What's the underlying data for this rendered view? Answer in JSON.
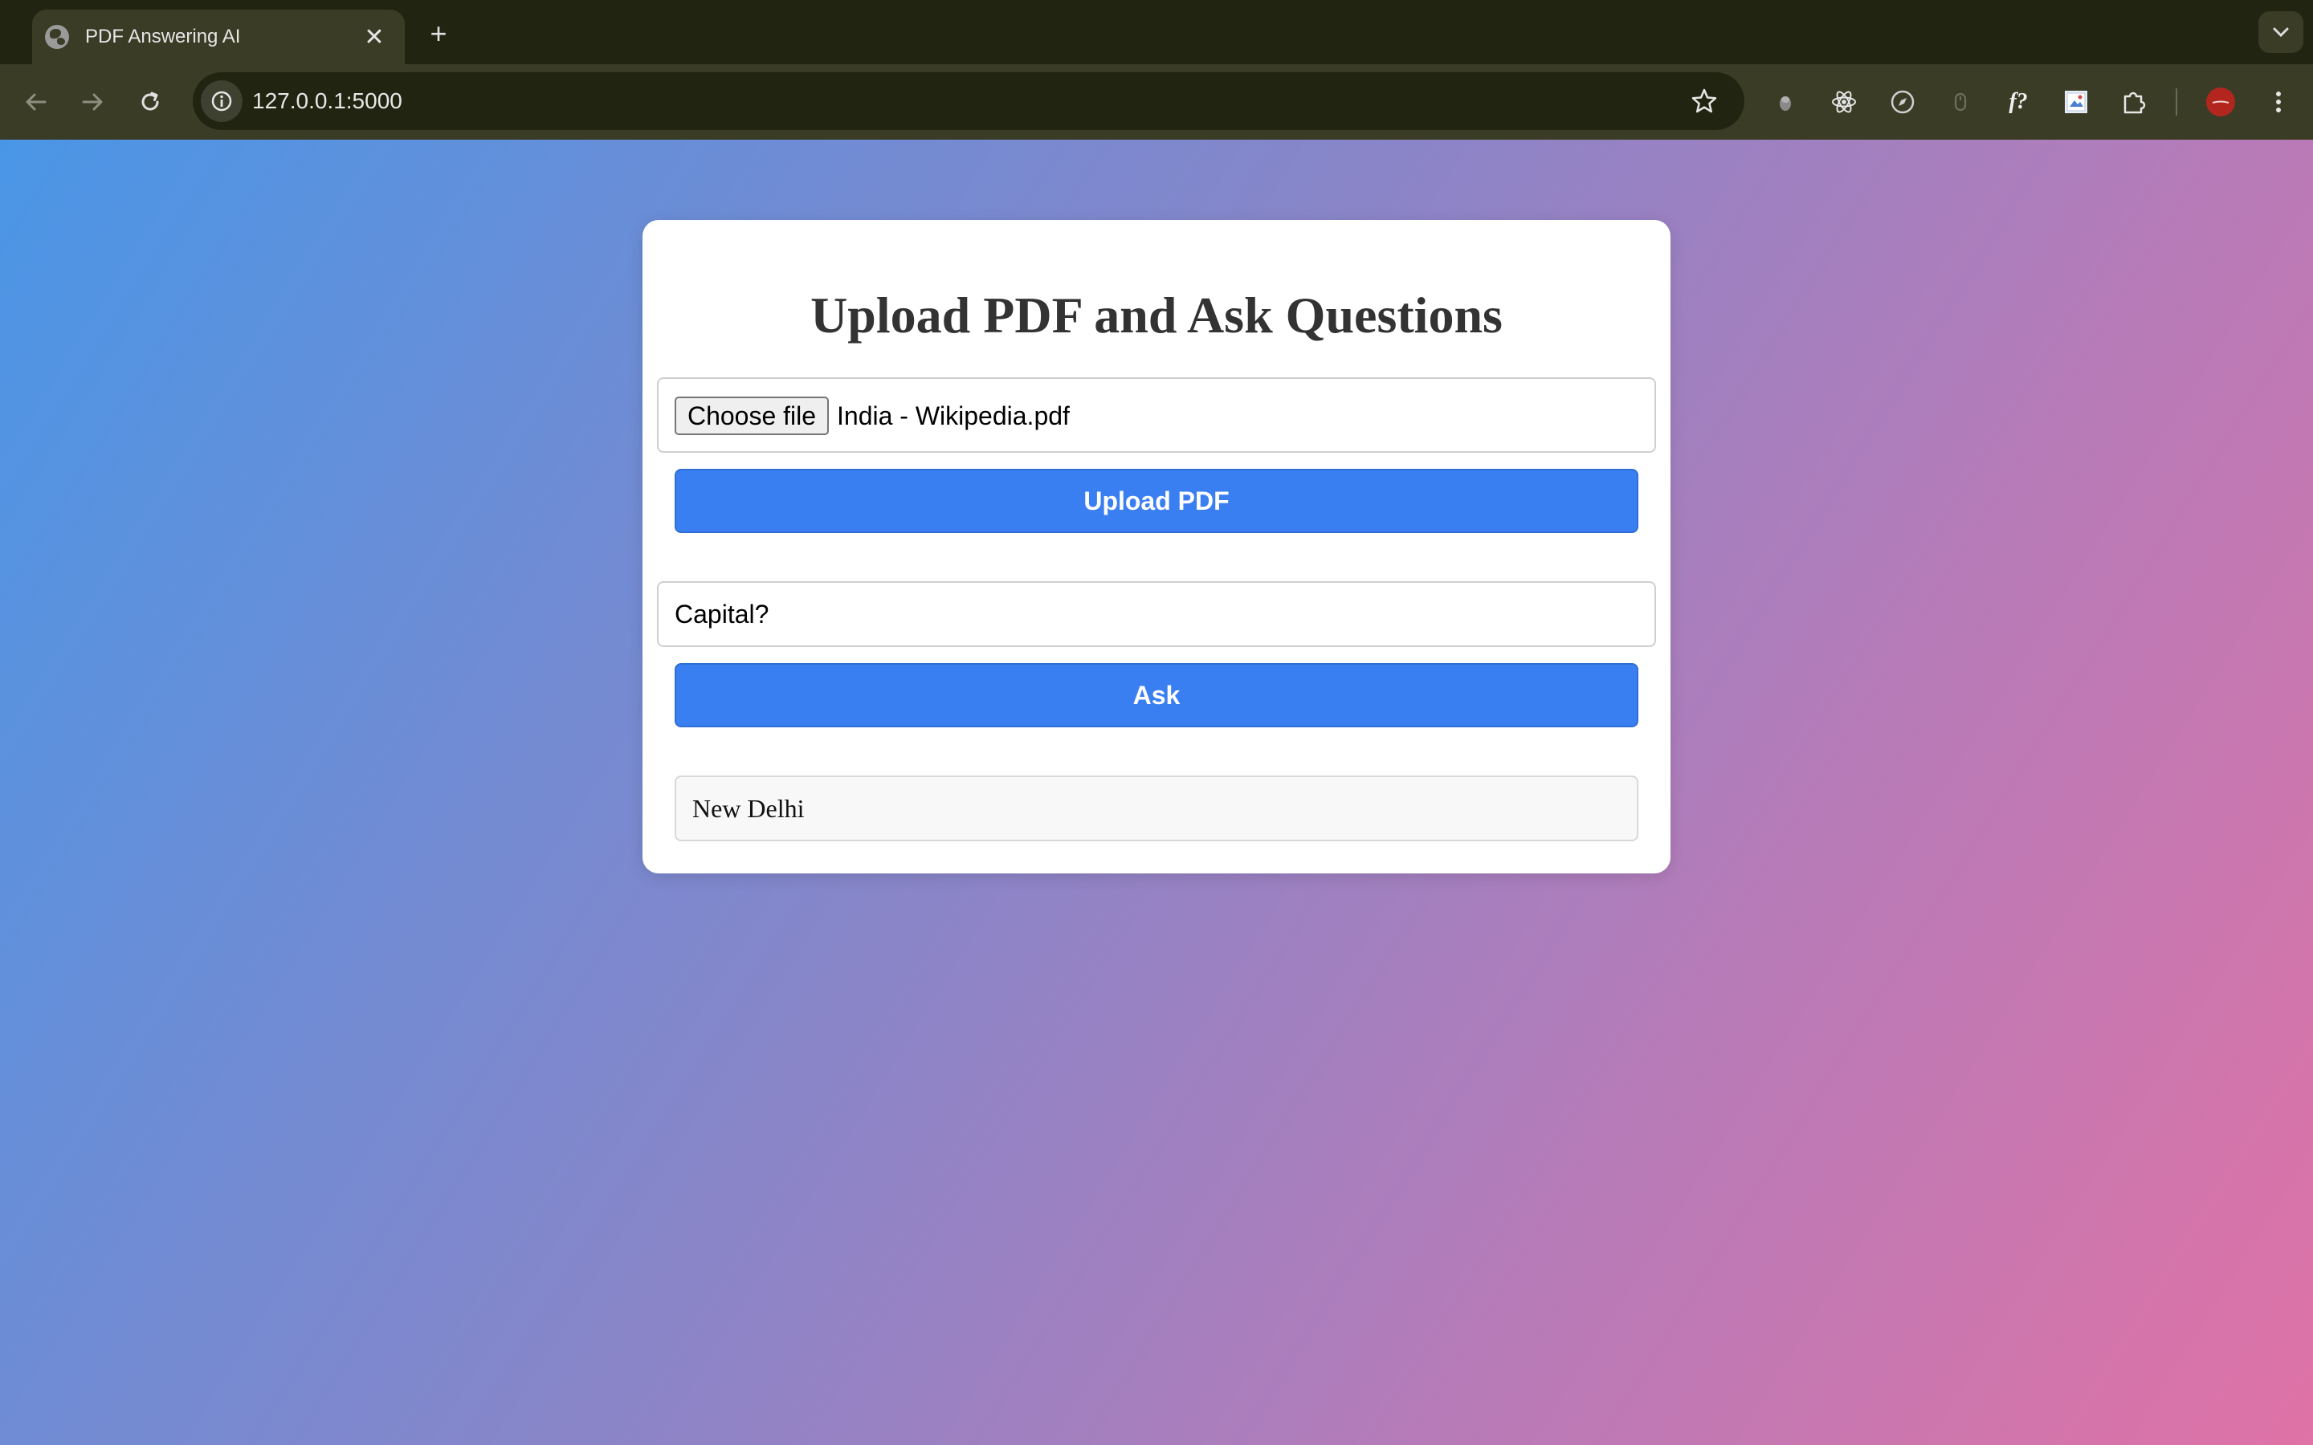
{
  "browser": {
    "tab": {
      "title": "PDF Answering AI"
    },
    "url": "127.0.0.1:5000"
  },
  "page": {
    "title": "Upload PDF and Ask Questions",
    "file_input": {
      "button_label": "Choose file",
      "file_name": "India - Wikipedia.pdf"
    },
    "upload_button": "Upload PDF",
    "question_input": {
      "value": "Capital?"
    },
    "ask_button": "Ask",
    "answer": "New Delhi"
  },
  "colors": {
    "primary_button": "#3a7ff2",
    "gradient_start": "#4a96e6",
    "gradient_end": "#df72a6"
  },
  "icons": {
    "tab": [
      "globe-icon",
      "close-icon",
      "plus-icon",
      "chevron-down-icon"
    ],
    "toolbar": [
      "back-arrow-icon",
      "forward-arrow-icon",
      "reload-icon",
      "site-info-icon",
      "star-icon",
      "extension-icon",
      "react-icon",
      "compass-icon",
      "mouse-icon",
      "font-icon",
      "image-extension-icon",
      "puzzle-icon",
      "profile-avatar-icon",
      "kebab-menu-icon"
    ]
  }
}
